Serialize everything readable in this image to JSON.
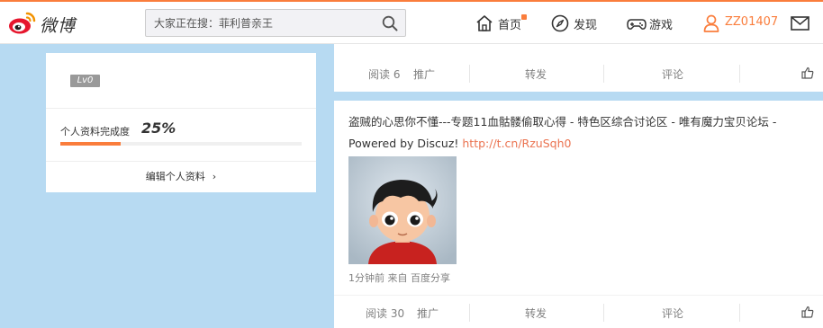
{
  "header": {
    "logo_text": "微博",
    "search": {
      "placeholder": "大家正在搜：菲利普亲王"
    },
    "nav": {
      "home": "首页",
      "discover": "发现",
      "game": "游戏",
      "user": "ZZ01407"
    },
    "colors": {
      "accent": "#fa7d3c",
      "brand_red": "#e6162d"
    }
  },
  "profile": {
    "level": "Lv0",
    "completion_label": "个人资料完成度",
    "completion_value": "25%",
    "completion_fraction": 0.25,
    "edit_label": "编辑个人资料",
    "edit_chevron": "›"
  },
  "feed": {
    "post1": {
      "read": "阅读 6",
      "promote": "推广",
      "forward": "转发",
      "comment": "评论"
    },
    "post2": {
      "text_line1": "盗贼的心思你不懂---专题11血骷髅偷取心得 - 特色区综合讨论区 - 唯有魔力宝贝论坛 - ",
      "text_line2_prefix": "Powered by Discuz! ",
      "link": "http://t.cn/RzuSqh0",
      "meta": "1分钟前 来自 百度分享",
      "read": "阅读 30",
      "promote": "推广",
      "forward": "转发",
      "comment": "评论"
    }
  },
  "icons": [
    "weibo-logo-icon",
    "search-icon",
    "home-icon",
    "compass-icon",
    "gamepad-icon",
    "user-icon",
    "mail-icon",
    "thumbs-up-icon",
    "chevron-right-icon"
  ]
}
